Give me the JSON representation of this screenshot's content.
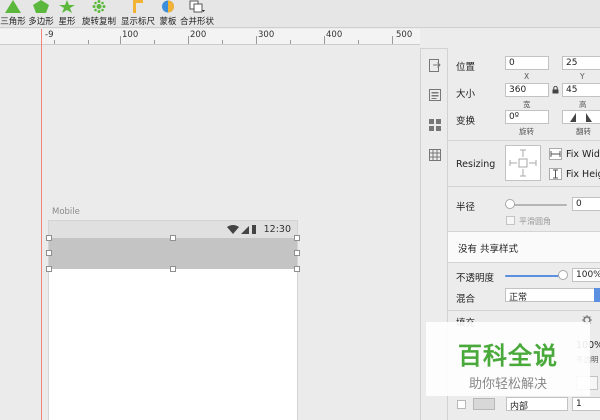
{
  "toolbar": {
    "items": [
      {
        "label": "三角形",
        "icon": "triangle-icon"
      },
      {
        "label": "多边形",
        "icon": "pentagon-icon"
      },
      {
        "label": "星形",
        "icon": "star-icon"
      },
      {
        "label": "旋转复制",
        "icon": "rotate-copy-icon"
      },
      {
        "label": "显示标尺",
        "icon": "ruler-icon"
      },
      {
        "label": "蒙板",
        "icon": "mask-icon"
      },
      {
        "label": "合并形状",
        "icon": "combine-shapes-icon"
      }
    ]
  },
  "ruler": {
    "labels": [
      "-9",
      "100",
      "200",
      "300",
      "400",
      "500"
    ]
  },
  "artboard": {
    "label": "Mobile",
    "status_time": "12:30"
  },
  "inspector": {
    "position": {
      "label": "位置",
      "x": "0",
      "y": "25",
      "x_label": "X",
      "y_label": "Y"
    },
    "size": {
      "label": "大小",
      "width": "360",
      "height": "45",
      "w_label": "宽",
      "h_label": "高"
    },
    "transform": {
      "label": "变换",
      "rotate": "0º",
      "rotate_label": "旋转",
      "flip_label": "翻转"
    },
    "resizing": {
      "label": "Resizing",
      "fix_width": "Fix Widt",
      "fix_height": "Fix Heig"
    },
    "radius": {
      "label": "半径",
      "value": "0",
      "smooth_label": "平滑圆角"
    },
    "shared_style": "没有 共享样式",
    "opacity": {
      "label": "不透明度",
      "value": "100%"
    },
    "blend": {
      "label": "混合",
      "value": "正常"
    },
    "fill": {
      "label": "填充",
      "opacity": "100%",
      "opacity_label": "不透明"
    },
    "border": {
      "position": "内部",
      "width": "1"
    }
  },
  "watermark": {
    "title": "百科全说",
    "subtitle": "助你轻松解决"
  },
  "colors": {
    "accent": "#5b8fe0",
    "guide": "#f0857a",
    "watermark_green": "#49a93a"
  }
}
